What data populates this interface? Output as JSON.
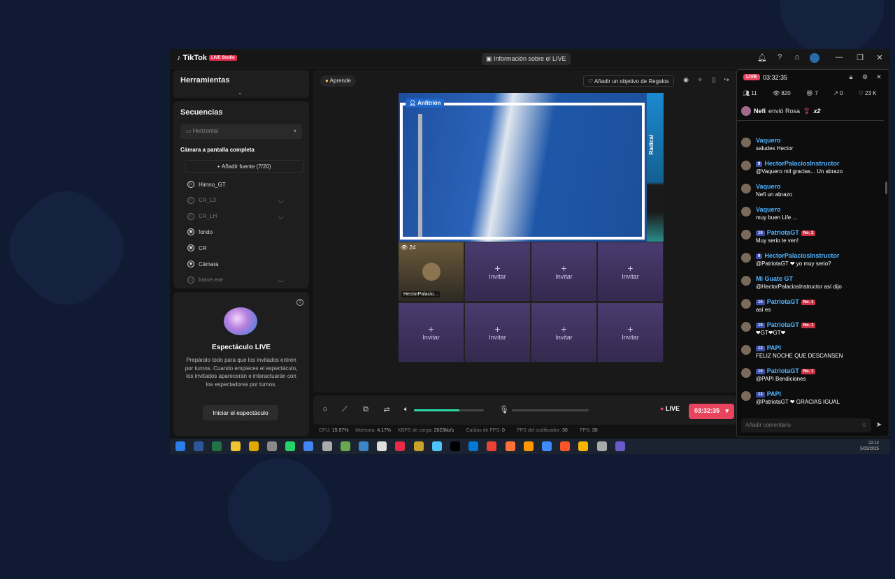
{
  "titlebar": {
    "app_name": "TikTok",
    "app_tag": "LIVE Studio",
    "info_button": "Información sobre el LIVE"
  },
  "tools": {
    "title": "Herramientas"
  },
  "sequences": {
    "title": "Secuencias",
    "layout": "Horizontal",
    "scene": "Cámara a pantalla completa",
    "add_source": "Añadir fuente (7/20)",
    "sources": [
      {
        "name": "Himno_GT",
        "icon": "play-icon",
        "dim": false
      },
      {
        "name": "CR_L3",
        "icon": "play-icon",
        "dim": true
      },
      {
        "name": "CR_LH",
        "icon": "play-icon",
        "dim": true
      },
      {
        "name": "fondo",
        "icon": "image-icon",
        "dim": false
      },
      {
        "name": "CR",
        "icon": "image-icon",
        "dim": false
      },
      {
        "name": "Cámara",
        "icon": "camera-icon",
        "dim": false
      },
      {
        "name": "brave.exe",
        "icon": "window-icon",
        "dim": true
      }
    ]
  },
  "show": {
    "title": "Espectáculo LIVE",
    "description": "Prepáralo todo para que los invitados entren por turnos. Cuando empieces el espectáculo, los invitados aparecerán e interactuarán con los espectadores por turnos.",
    "button": "Iniciar el espectáculo"
  },
  "stage": {
    "learn_chip": "Aprende",
    "goal_button": "Añadir un objetivo de Regalos",
    "host_badge": "Anfitrión",
    "side_text": "Radical",
    "guest": {
      "name": "HectorPalacio...",
      "viewers": "24"
    },
    "invite_label": "Invitar"
  },
  "controls": {
    "live_label": "LIVE",
    "timer": "03:32:35",
    "volume": 0.65
  },
  "stats": {
    "cpu_label": "CPU:",
    "cpu": "15.97%",
    "mem_label": "Memoria:",
    "mem": "4.17%",
    "kbps_label": "KBPS de carga:",
    "kbps": "2023kb/s",
    "drop_label": "Caídas de FPS:",
    "drop": "0",
    "enc_label": "FPS del codificador:",
    "enc": "30",
    "fps_label": "FPS:",
    "fps": "30"
  },
  "chat": {
    "live_pill": "LIVE",
    "time": "03:32:35",
    "counts": {
      "guests": "11",
      "views": "820",
      "gifts": "7",
      "shares": "0",
      "likes": "23 K"
    },
    "gift_msg": {
      "user": "Nefi",
      "text": "envió Rosa",
      "mult": "x2"
    },
    "messages": [
      {
        "name": "Vaquero",
        "level": "",
        "badge": "",
        "text": "saludes Hector"
      },
      {
        "name": "HectorPalaciosInstructor",
        "level": "9",
        "badge": "",
        "text": "@Vaquero mil gracias... Un abrazo"
      },
      {
        "name": "Vaquero",
        "level": "",
        "badge": "",
        "text": "Nefi un abrazo"
      },
      {
        "name": "Vaquero",
        "level": "",
        "badge": "",
        "text": "muy buen Life ..."
      },
      {
        "name": "PatriotaGT",
        "level": "10",
        "badge": "No. 2",
        "text": "Muy serio te ven!"
      },
      {
        "name": "HectorPalaciosInstructor",
        "level": "9",
        "badge": "",
        "text": "@PatriotaGT ❤ yo muy serio?"
      },
      {
        "name": "Mi Guate GT",
        "level": "",
        "badge": "",
        "text": "@HectorPalaciosInstructor así dijo"
      },
      {
        "name": "PatriotaGT",
        "level": "10",
        "badge": "No. 1",
        "text": "así es"
      },
      {
        "name": "PatriotaGT",
        "level": "10",
        "badge": "No. 1",
        "text": "❤GT❤GT❤"
      },
      {
        "name": "PAPI",
        "level": "13",
        "badge": "",
        "text": "FELIZ NOCHE QUE DESCANSEN"
      },
      {
        "name": "PatriotaGT",
        "level": "10",
        "badge": "No. 1",
        "text": "@PAPI Bendiciones"
      },
      {
        "name": "PAPI",
        "level": "13",
        "badge": "",
        "text": "@PatriotaGT ❤ GRACIAS IGUAL"
      }
    ],
    "input_placeholder": "Añadir comentario"
  },
  "taskbar": {
    "time": "22:12",
    "date": "5/03/2025"
  }
}
